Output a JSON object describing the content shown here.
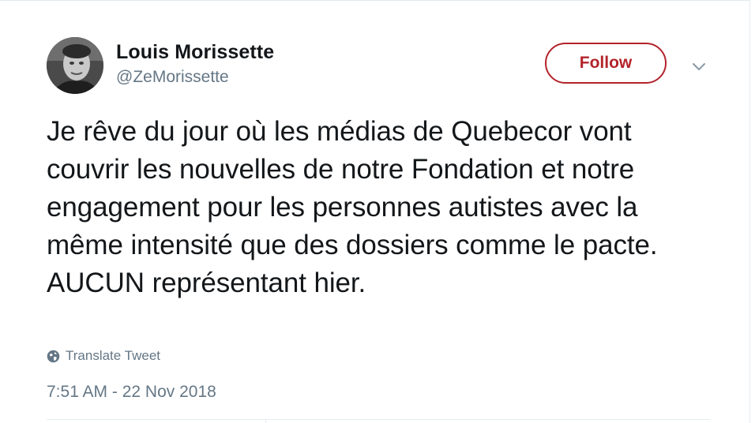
{
  "tweet": {
    "author": {
      "display_name": "Louis Morissette",
      "handle": "@ZeMorissette"
    },
    "follow_label": "Follow",
    "text": "Je rêve du jour où les médias de Quebecor vont couvrir les nouvelles de notre Fondation et notre engagement pour les personnes autistes avec la même intensité que des dossiers comme le pacte. AUCUN représentant hier.",
    "translate_label": "Translate Tweet",
    "timestamp": "7:51 AM - 22 Nov 2018"
  },
  "icons": {
    "menu": "chevron-down-icon",
    "translate": "globe-icon"
  },
  "colors": {
    "follow_accent": "#b3232b",
    "secondary_text": "#657786",
    "primary_text": "#14171a",
    "divider": "#e6ecf0"
  }
}
